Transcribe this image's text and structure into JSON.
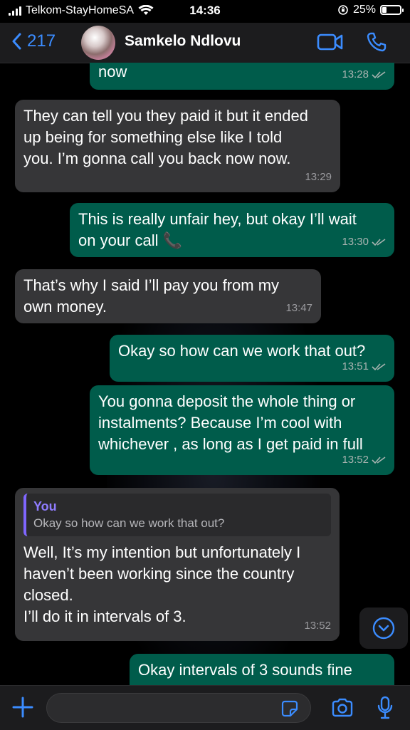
{
  "status_bar": {
    "carrier": "Telkom-StayHomeSA",
    "time": "14:36",
    "battery_percent": "25%",
    "battery_level": 0.25
  },
  "header": {
    "back_count": "217",
    "contact_name": "Samkelo Ndlovu"
  },
  "messages": [
    {
      "text": "now",
      "time": "13:28"
    },
    {
      "text": "They can tell you they paid it but it ended\nup being for something else like I told\nyou. I’m gonna call you back now now.",
      "time": "13:29"
    },
    {
      "text": "This is really unfair hey, but okay I’ll wait\non your call 📞",
      "time": "13:30"
    },
    {
      "text": "That’s why I said I’ll pay you from my\nown money.",
      "time": "13:47"
    },
    {
      "text": "Okay so how can we work that out?",
      "time": "13:51"
    },
    {
      "text": "You gonna deposit the whole thing or\ninstalments? Because I’m cool with\nwhichever , as long as I get paid in full",
      "time": "13:52"
    },
    {
      "quote_author": "You",
      "quote_text": "Okay so how can we work that out?",
      "text": "Well, It’s my intention but unfortunately I\nhaven’t been working since the country\nclosed.\nI’ll do it in intervals of 3.",
      "time": "13:52"
    },
    {
      "text": "Okay intervals of 3 sounds fine",
      "time": ""
    }
  ],
  "input": {
    "value": "",
    "placeholder": ""
  },
  "colors": {
    "accent": "#3b8cff",
    "outgoing_bubble": "#005c4b",
    "incoming_bubble": "#363638",
    "quote_author": "#8f7cff"
  },
  "icons": [
    "wifi-icon",
    "orientation-lock-icon",
    "back-chevron-icon",
    "video-call-icon",
    "phone-call-icon",
    "read-ticks-icon",
    "scroll-down-icon",
    "plus-icon",
    "sticker-icon",
    "camera-icon",
    "mic-icon"
  ]
}
